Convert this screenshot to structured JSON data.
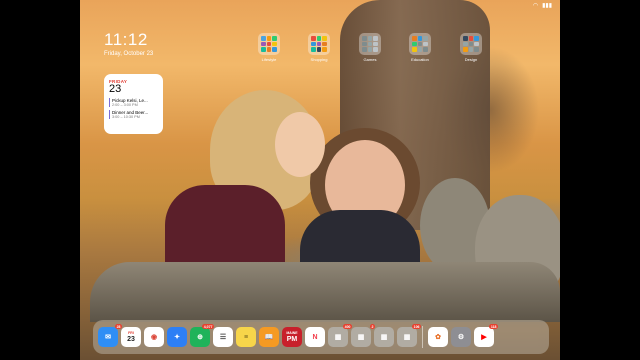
{
  "status": {
    "battery": "▮▮▮",
    "wifi": "◠"
  },
  "clock": {
    "time": "11:12",
    "date": "Friday, October 23"
  },
  "calendar_widget": {
    "weekday": "FRIDAY",
    "day": "23",
    "events": [
      {
        "title": "Pickup Kelsi, Le...",
        "time": "2:00 – 3:00 PM"
      },
      {
        "title": "Dinner and Beer...",
        "time": "3:00 – 10:30 PM"
      }
    ]
  },
  "folders": [
    {
      "label": "Lifestyle",
      "colors": [
        "#4aa3df",
        "#f39c12",
        "#2ecc71",
        "#9b59b6",
        "#e74c3c",
        "#f1c40f",
        "#1abc9c",
        "#e67e22",
        "#3498db"
      ]
    },
    {
      "label": "Shopping",
      "colors": [
        "#e74c3c",
        "#2ecc71",
        "#f1c40f",
        "#3498db",
        "#9b59b6",
        "#e67e22",
        "#1abc9c",
        "#34495e",
        "#f39c12"
      ]
    },
    {
      "label": "Games",
      "colors": [
        "#7f8c8d",
        "#95a5a6",
        "#bdc3c7",
        "#7f8c8d",
        "#95a5a6",
        "#bdc3c7",
        "#7f8c8d",
        "#95a5a6",
        "#bdc3c7"
      ]
    },
    {
      "label": "Education",
      "colors": [
        "#e67e22",
        "#3498db",
        "#95a5a6",
        "#2ecc71",
        "#7f8c8d",
        "#bdc3c7",
        "#f1c40f",
        "#95a5a6",
        "#7f8c8d"
      ]
    },
    {
      "label": "Design",
      "colors": [
        "#34495e",
        "#e74c3c",
        "#3498db",
        "#95a5a6",
        "#7f8c8d",
        "#bdc3c7",
        "#f39c12",
        "#95a5a6",
        "#7f8c8d"
      ]
    }
  ],
  "dock": {
    "apps": [
      {
        "name": "mail-icon",
        "color": "#2f8ef5",
        "glyph": "✉",
        "badge": "28"
      },
      {
        "name": "calendar-icon",
        "color": "#ffffff",
        "glyph": "23",
        "sub": "FRI",
        "text_color": "#222"
      },
      {
        "name": "chrome-icon",
        "color": "#ffffff",
        "glyph": "◉",
        "text_color": "#db4437"
      },
      {
        "name": "safari-icon",
        "color": "#2d7ff5",
        "glyph": "✦"
      },
      {
        "name": "authy-icon",
        "color": "#1fb35a",
        "glyph": "⊕",
        "badge": "4,077"
      },
      {
        "name": "reminders-icon",
        "color": "#ffffff",
        "glyph": "☰",
        "text_color": "#555"
      },
      {
        "name": "notes-icon",
        "color": "#f7d54a",
        "glyph": "≡",
        "text_color": "#6b5a1a"
      },
      {
        "name": "books-icon",
        "color": "#f59a23",
        "glyph": "📖"
      },
      {
        "name": "maine-icon",
        "color": "#c8202b",
        "glyph": "PM",
        "sub": "MAINE"
      },
      {
        "name": "news-icon",
        "color": "#ffffff",
        "glyph": "N",
        "text_color": "#f23c4a"
      },
      {
        "name": "folder-a-icon",
        "color": "#b1aca3",
        "glyph": "▦",
        "badge": "400"
      },
      {
        "name": "folder-b-icon",
        "color": "#b1aca3",
        "glyph": "▦",
        "badge": "2"
      },
      {
        "name": "folder-c-icon",
        "color": "#b1aca3",
        "glyph": "▦"
      },
      {
        "name": "folder-d-icon",
        "color": "#b1aca3",
        "glyph": "▦",
        "badge": "106"
      },
      {
        "name": "photos-icon",
        "color": "#ffffff",
        "glyph": "✿",
        "text_color": "#e8712a"
      },
      {
        "name": "settings-icon",
        "color": "#8e8e93",
        "glyph": "⚙"
      },
      {
        "name": "youtube-icon",
        "color": "#ffffff",
        "glyph": "▶",
        "text_color": "#ff0000",
        "badge": "118"
      }
    ]
  }
}
